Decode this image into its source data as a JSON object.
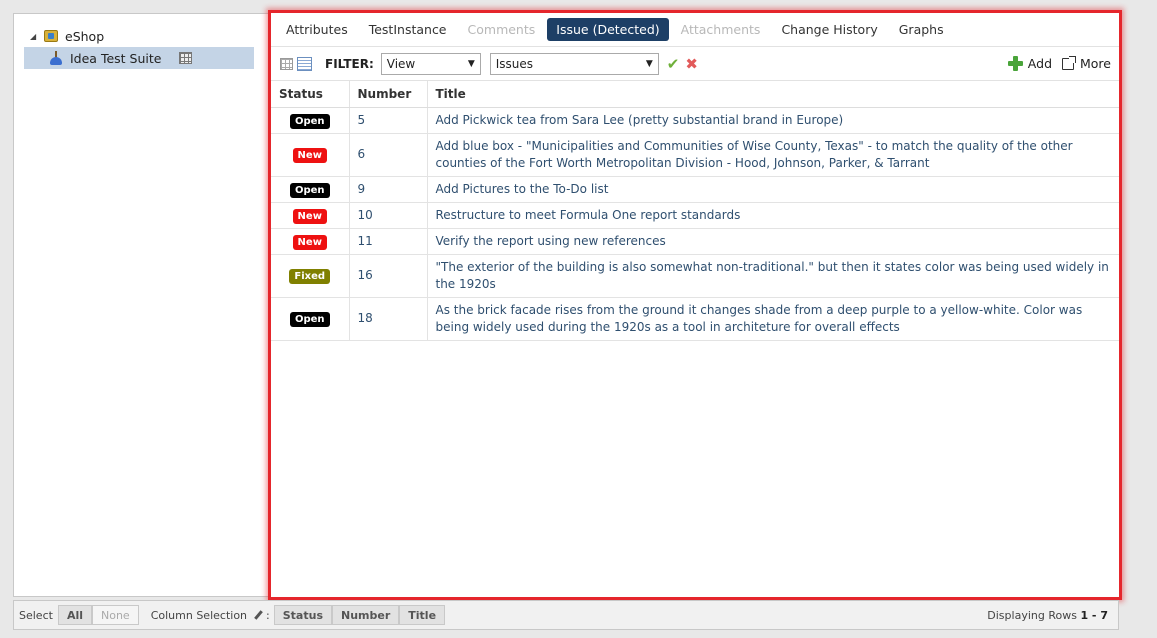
{
  "tree": {
    "root": {
      "label": "eShop"
    },
    "child": {
      "label": "Idea Test Suite"
    }
  },
  "tabs": [
    {
      "label": "Attributes",
      "state": "normal"
    },
    {
      "label": "TestInstance",
      "state": "normal"
    },
    {
      "label": "Comments",
      "state": "disabled"
    },
    {
      "label": "Issue (Detected)",
      "state": "active"
    },
    {
      "label": "Attachments",
      "state": "disabled"
    },
    {
      "label": "Change History",
      "state": "normal"
    },
    {
      "label": "Graphs",
      "state": "normal"
    }
  ],
  "toolbar": {
    "filter_label": "FILTER:",
    "view_select": "View",
    "type_select": "Issues",
    "add_label": "Add",
    "more_label": "More"
  },
  "table": {
    "headers": {
      "status": "Status",
      "number": "Number",
      "title": "Title"
    },
    "rows": [
      {
        "status": "Open",
        "number": "5",
        "title": "Add Pickwick tea from Sara Lee (pretty substantial brand in Europe)"
      },
      {
        "status": "New",
        "number": "6",
        "title": "Add blue box - \"Municipalities and Communities of Wise County, Texas\" - to match the quality of the other counties of the Fort Worth Metropolitan Division - Hood, Johnson, Parker, & Tarrant"
      },
      {
        "status": "Open",
        "number": "9",
        "title": "Add Pictures to the To-Do list"
      },
      {
        "status": "New",
        "number": "10",
        "title": "Restructure to meet Formula One report standards"
      },
      {
        "status": "New",
        "number": "11",
        "title": "Verify the report using new references"
      },
      {
        "status": "Fixed",
        "number": "16",
        "title": "\"The exterior of the building is also somewhat non-traditional.\" but then it states color was being used widely in the 1920s"
      },
      {
        "status": "Open",
        "number": "18",
        "title": "As the brick facade rises from the ground it changes shade from a deep purple to a yellow-white. Color was being widely used during the 1920s as a tool in architeture for overall effects"
      }
    ]
  },
  "status_colors": {
    "Open": "#000000",
    "New": "#ee1111",
    "Fixed": "#808000"
  },
  "bottom_bar": {
    "select_label": "Select",
    "all_label": "All",
    "none_label": "None",
    "column_selection_label": "Column Selection",
    "colon": ":",
    "columns": [
      "Status",
      "Number",
      "Title"
    ],
    "displaying_label": "Displaying Rows",
    "displaying_range": "1 - 7"
  }
}
